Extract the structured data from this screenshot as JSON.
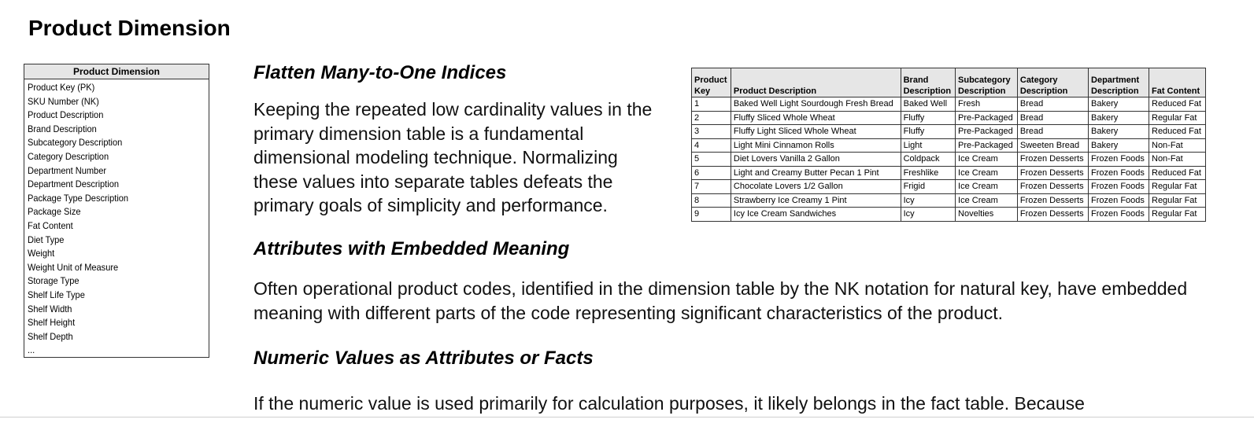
{
  "page": {
    "title": "Product Dimension"
  },
  "attribute_box": {
    "header": "Product Dimension",
    "items": [
      "Product Key (PK)",
      "SKU Number (NK)",
      "Product Description",
      "Brand Description",
      "Subcategory Description",
      "Category Description",
      "Department Number",
      "Department Description",
      "Package Type Description",
      "Package Size",
      "Fat Content",
      "Diet Type",
      "Weight",
      "Weight Unit of Measure",
      "Storage Type",
      "Shelf Life Type",
      "Shelf Width",
      "Shelf Height",
      "Shelf Depth",
      "..."
    ]
  },
  "sections": [
    {
      "heading": "Flatten Many-to-One Indices",
      "body": "Keeping the repeated low cardinality values in the primary dimension table is a fundamental dimensional modeling technique. Normalizing these values into separate tables defeats the primary goals of simplicity and performance."
    },
    {
      "heading": "Attributes with Embedded Meaning",
      "body": "Often operational product codes, identified in the dimension table by the NK notation for natural key, have embedded meaning with different parts of the code representing significant characteristics of the product."
    },
    {
      "heading": "Numeric Values as Attributes or Facts",
      "body": "If the numeric value is used primarily for calculation purposes, it likely belongs in the fact table. Because"
    }
  ],
  "sample_table": {
    "headers": [
      [
        "Product",
        "Key"
      ],
      [
        "",
        "Product Description"
      ],
      [
        "Brand",
        "Description"
      ],
      [
        "Subcategory",
        "Description"
      ],
      [
        "Category",
        "Description"
      ],
      [
        "Department",
        "Description"
      ],
      [
        "",
        "Fat Content"
      ]
    ],
    "rows": [
      [
        "1",
        "Baked Well Light Sourdough Fresh Bread",
        "Baked Well",
        "Fresh",
        "Bread",
        "Bakery",
        "Reduced Fat"
      ],
      [
        "2",
        "Fluffy Sliced Whole Wheat",
        "Fluffy",
        "Pre-Packaged",
        "Bread",
        "Bakery",
        "Regular Fat"
      ],
      [
        "3",
        "Fluffy Light Sliced Whole Wheat",
        "Fluffy",
        "Pre-Packaged",
        "Bread",
        "Bakery",
        "Reduced Fat"
      ],
      [
        "4",
        "Light Mini Cinnamon Rolls",
        "Light",
        "Pre-Packaged",
        "Sweeten Bread",
        "Bakery",
        "Non-Fat"
      ],
      [
        "5",
        "Diet Lovers Vanilla 2 Gallon",
        "Coldpack",
        "Ice Cream",
        "Frozen Desserts",
        "Frozen Foods",
        "Non-Fat"
      ],
      [
        "6",
        "Light and Creamy Butter Pecan 1 Pint",
        "Freshlike",
        "Ice Cream",
        "Frozen Desserts",
        "Frozen Foods",
        "Reduced Fat"
      ],
      [
        "7",
        "Chocolate Lovers 1/2 Gallon",
        "Frigid",
        "Ice Cream",
        "Frozen Desserts",
        "Frozen Foods",
        "Regular Fat"
      ],
      [
        "8",
        "Strawberry Ice Creamy 1 Pint",
        "Icy",
        "Ice Cream",
        "Frozen Desserts",
        "Frozen Foods",
        "Regular Fat"
      ],
      [
        "9",
        "Icy Ice Cream Sandwiches",
        "Icy",
        "Novelties",
        "Frozen Desserts",
        "Frozen Foods",
        "Regular Fat"
      ]
    ]
  }
}
